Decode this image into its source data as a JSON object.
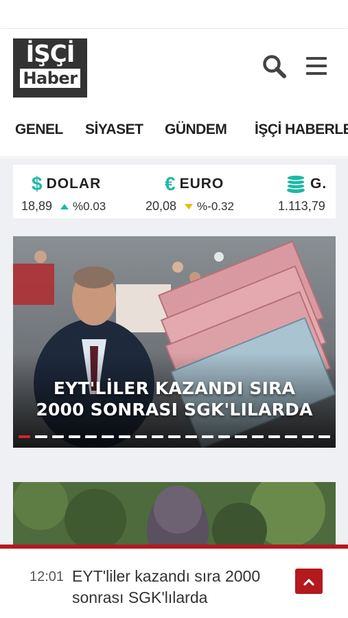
{
  "brand": {
    "logo_top": "İŞÇİ",
    "logo_bottom": "Haber"
  },
  "header": {
    "search_icon": "search-icon",
    "menu_icon": "hamburger-menu-icon"
  },
  "nav": {
    "items": [
      {
        "label": "GENEL"
      },
      {
        "label": "SİYASET"
      },
      {
        "label": "GÜNDEM"
      },
      {
        "label": "İŞÇİ HABERLE"
      }
    ]
  },
  "ticker": {
    "items": [
      {
        "name": "DOLAR",
        "symbol": "$",
        "icon": "dollar-icon",
        "value": "18,89",
        "change": "%0.03",
        "trend": "up"
      },
      {
        "name": "EURO",
        "symbol": "€",
        "icon": "euro-icon",
        "value": "20,08",
        "change": "%-0.32",
        "trend": "down"
      },
      {
        "name": "G.",
        "symbol": "",
        "icon": "gold-coins-icon",
        "value": "1.113,79",
        "change": "",
        "trend": ""
      }
    ]
  },
  "slider": {
    "title_line1": "EYT'LİLER KAZANDI SIRA",
    "title_line2": "2000 SONRASI SGK'LILARDA",
    "active_index": 0,
    "total": 19
  },
  "breaking_news": {
    "time": "12:01",
    "text": "EYT'liler kazandı sıra 2000 sonrası SGK'lılarda",
    "up_icon": "chevron-up-icon"
  },
  "colors": {
    "accent_red": "#b4191d",
    "teal": "#1fb8a5",
    "yellow": "#f2b705",
    "logo_bg": "#333333"
  }
}
